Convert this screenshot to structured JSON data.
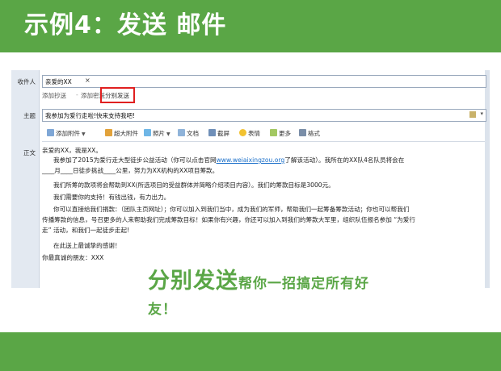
{
  "slide": {
    "title": "示例4：发送 邮件",
    "caption_big": "分别发送",
    "caption_small": "帮你一招搞定所有好",
    "caption_line2": "友！"
  },
  "compose": {
    "recipient_label": "收件人",
    "recipient_chip": "亲爱的XX",
    "recipient_remove": "×",
    "add_cc": "添加抄送",
    "add_bcc": "添加密送",
    "separator": "-",
    "send_separately": "分别发送",
    "subject_label": "主题",
    "subject_value": "我参加为爱行走啦!快来支持我吧!",
    "body_label": "正文"
  },
  "toolbar": {
    "attachment": "添加附件",
    "large_attachment": "超大附件",
    "photo": "照片",
    "document": "文档",
    "screenshot": "截屏",
    "emoji": "表情",
    "more": "更多",
    "format": "格式"
  },
  "colors": {
    "brand_green": "#5aa646",
    "highlight_red": "#e02020",
    "link_blue": "#1a6fc9"
  },
  "icons": {
    "attachment": "paperclip-icon",
    "large_attachment": "large-attachment-icon",
    "photo": "photo-icon",
    "document": "document-icon",
    "screenshot": "screenshot-icon",
    "emoji": "emoji-icon",
    "more": "more-icon",
    "format": "format-icon"
  },
  "body": {
    "l1": "亲爱的XX，我是XX。",
    "l2a": "我参加了2015为爱行走大型徒步公益活动（你可以点击官网",
    "l2_link": "www.weiaixingzou.org",
    "l2b": "了解该活动）。我所在的XX队4名队员将会在",
    "l3": "____月____日徒步挑战____公里，努力为XX机构的XX项目筹款。",
    "l4": "我们所筹的款项将会帮助到XX(所选项目的受益群体并简略介绍项目内容）。我们的筹款目标是3000元。",
    "l5": "我们需要你的支持！有钱出钱，有力出力。",
    "l6": "你可以直接给我们捐款：（团队主页网址）；你可以加入到我们当中，成为我们的军师，帮助我们一起筹备筹款活动；你也可以帮我们",
    "l7": "传播筹款的信息，号召更多的人来帮助我们完成筹款目标！如果你有兴趣，你还可以加入到我们的筹款大军里，组织队伍报名参加 “为爱行",
    "l8": "走” 活动，和我们一起徒步走起!",
    "l9": "在此送上最诚挚的感谢！",
    "l10": "你最真诚的朋友：XXX"
  }
}
